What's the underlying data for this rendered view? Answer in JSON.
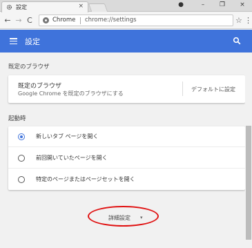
{
  "browser": {
    "tab": {
      "title": "設定",
      "close": "×",
      "icon": "gear-icon"
    },
    "window_controls": {
      "account": "●",
      "minimize": "–",
      "restore": "❐",
      "close": "×"
    },
    "toolbar": {
      "back": "←",
      "forward": "→",
      "reload": "C",
      "site_label": "Chrome",
      "url": "chrome://settings",
      "star": "☆",
      "menu": "⋮"
    }
  },
  "header": {
    "title": "設定",
    "menu_icon": "hamburger-icon",
    "search_icon": "search-icon"
  },
  "default_browser": {
    "section_label": "既定のブラウザ",
    "card_title": "既定のブラウザ",
    "card_subtitle": "Google Chrome を既定のブラウザにする",
    "action_label": "デフォルトに設定"
  },
  "startup": {
    "section_label": "起動時",
    "options": [
      {
        "label": "新しいタブ ページを開く",
        "selected": true
      },
      {
        "label": "前回開いていたページを開く",
        "selected": false
      },
      {
        "label": "特定のページまたはページセットを開く",
        "selected": false
      }
    ]
  },
  "advanced": {
    "label": "詳細設定",
    "chevron": "▾"
  },
  "colors": {
    "accent": "#3f73db",
    "highlight": "#e01010"
  }
}
